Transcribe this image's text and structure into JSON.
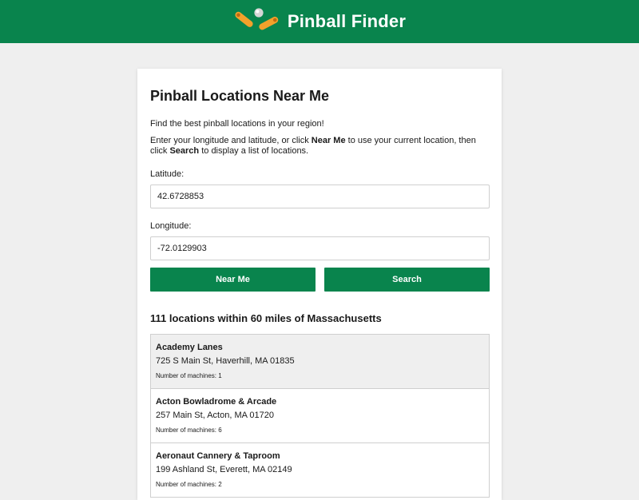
{
  "header": {
    "title": "Pinball Finder",
    "logo_icon": "pinball-flippers-logo",
    "background_color": "#09844d"
  },
  "main": {
    "title": "Pinball Locations Near Me",
    "intro": "Find the best pinball locations in your region!",
    "instructions": {
      "part1": "Enter your longitude and latitude, or click ",
      "near_me": "Near Me",
      "part2": " to use your current location, then click ",
      "search": "Search",
      "part3": " to display a list of locations."
    },
    "latitude": {
      "label": "Latitude:",
      "value": "42.6728853"
    },
    "longitude": {
      "label": "Longitude:",
      "value": "-72.0129903"
    },
    "buttons": {
      "near_me": "Near Me",
      "search": "Search"
    }
  },
  "results": {
    "heading": "111 locations within 60 miles of Massachusetts",
    "items": [
      {
        "name": "Academy Lanes",
        "address": "725 S Main St, Haverhill, MA 01835",
        "machines": "Number of machines: 1",
        "selected": true
      },
      {
        "name": "Acton Bowladrome & Arcade",
        "address": "257 Main St, Acton, MA 01720",
        "machines": "Number of machines: 6",
        "selected": false
      },
      {
        "name": "Aeronaut Cannery & Taproom",
        "address": "199 Ashland St, Everett, MA 02149",
        "machines": "Number of machines: 2",
        "selected": false
      }
    ]
  },
  "colors": {
    "accent": "#09844d",
    "flipper": "#f2a12b",
    "background": "#efefef"
  }
}
